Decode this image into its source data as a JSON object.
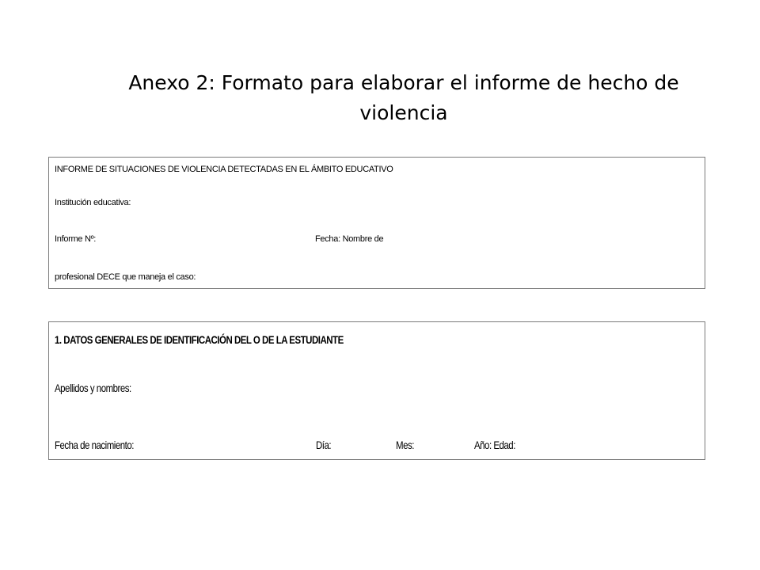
{
  "slide": {
    "title": "Anexo 2: Formato para elaborar el informe de hecho de violencia"
  },
  "form_header": {
    "heading": "INFORME DE SITUACIONES DE VIOLENCIA DETECTADAS EN EL ÁMBITO EDUCATIVO",
    "institution_label": "Institución educativa:",
    "report_number_label": "Informe Nº:",
    "date_label": "Fecha: Nombre de",
    "professional_label": "profesional DECE que maneja el caso:"
  },
  "student_section": {
    "heading": "1. DATOS GENERALES DE IDENTIFICACIÓN DEL O DE LA ESTUDIANTE",
    "names_label": "Apellidos y nombres:",
    "birth_date_label": "Fecha de nacimiento:",
    "day_label": "Día:",
    "month_label": "Mes:",
    "year_age_label": "Año: Edad:"
  }
}
